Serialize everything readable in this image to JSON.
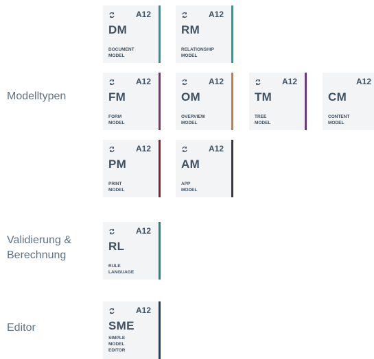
{
  "colors": {
    "label": "#5f7183",
    "card_bg": "#f3f4f6",
    "card_text": "#3f5060",
    "teal": "#1f9a95",
    "purple": "#8b2a6f",
    "orange": "#c97c3e",
    "violet": "#6a3a7e",
    "maroon": "#8c1d2a",
    "dark": "#3a3542",
    "green": "#1a8a7a",
    "navy": "#1f3d6b"
  },
  "rows": {
    "modelltypen": "Modelltypen",
    "validierung_line1": "Validierung &",
    "validierung_line2": "Berechnung",
    "editor": "Editor"
  },
  "brand": "A12",
  "cards": {
    "dm": {
      "abbr": "DM",
      "desc": "DOCUMENT\nMODEL",
      "icon": "sync-icon"
    },
    "rm": {
      "abbr": "RM",
      "desc": "RELATIONSHIP\nMODEL",
      "icon": "sync-icon"
    },
    "fm": {
      "abbr": "FM",
      "desc": "FORM\nMODEL",
      "icon": "sync-icon"
    },
    "om": {
      "abbr": "OM",
      "desc": "OVERVIEW\nMODEL",
      "icon": "sync-icon"
    },
    "tm": {
      "abbr": "TM",
      "desc": "TREE\nMODEL",
      "icon": "sync-icon"
    },
    "cm": {
      "abbr": "CM",
      "desc": "CONTENT\nMODEL",
      "icon": ""
    },
    "pm": {
      "abbr": "PM",
      "desc": "PRINT\nMODEL",
      "icon": "sync-icon"
    },
    "am": {
      "abbr": "AM",
      "desc": "APP\nMODEL",
      "icon": "sync-icon"
    },
    "rl": {
      "abbr": "RL",
      "desc": "RULE\nLANGUAGE",
      "icon": "sync-icon"
    },
    "sme": {
      "abbr": "SME",
      "desc": "SIMPLE\nMODEL\nEDITOR",
      "icon": "sync-icon"
    }
  }
}
